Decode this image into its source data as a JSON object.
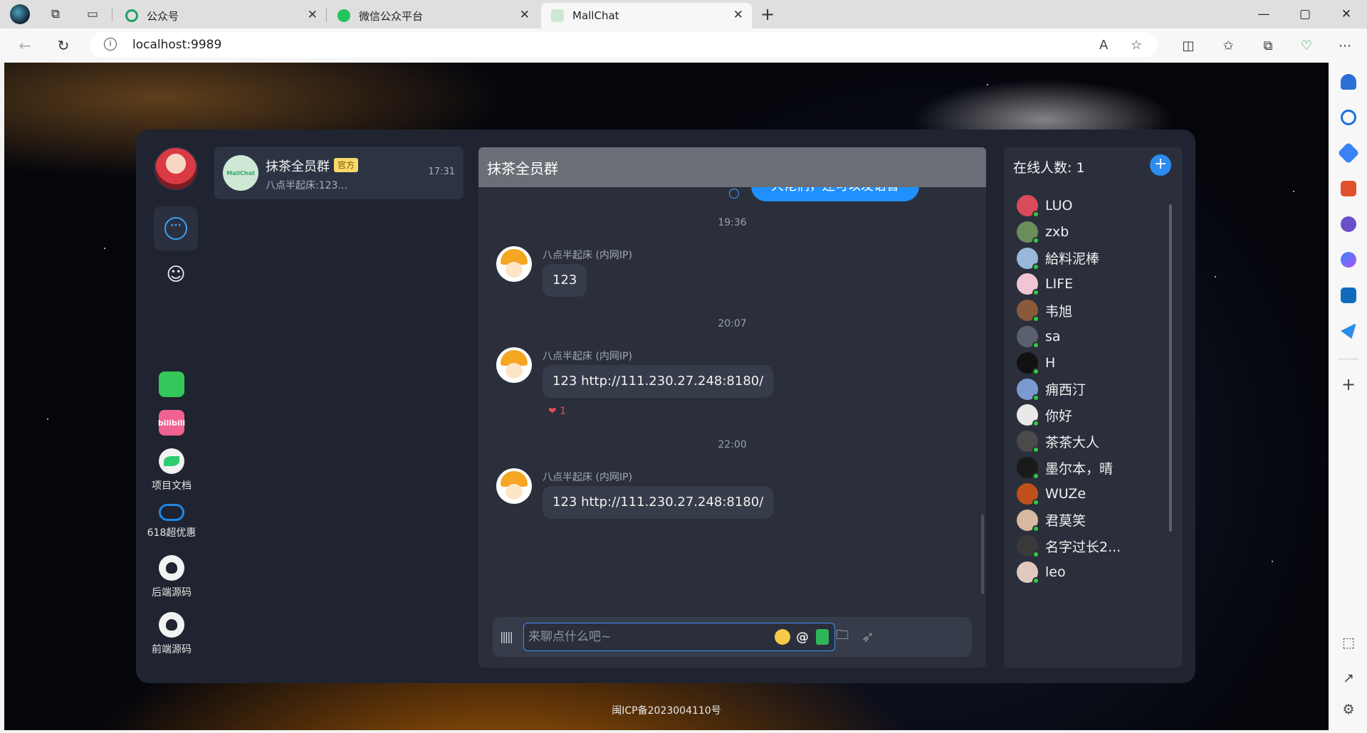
{
  "browser": {
    "tabs": [
      {
        "title": "公众号",
        "color": "#1aa260"
      },
      {
        "title": "微信公众平台",
        "color": "#22c55e"
      },
      {
        "title": "MallChat",
        "color": "#cfe8d5"
      }
    ],
    "url": "localhost:9989",
    "window_buttons": {
      "minimize": "—",
      "maximize": "▢",
      "close": "✕"
    }
  },
  "app": {
    "nav": {
      "links": [
        {
          "name": "wechat",
          "label": "",
          "icon_text": "",
          "color": "#34c759"
        },
        {
          "name": "bilibili",
          "label": "",
          "icon_text": "bilibili",
          "color": "#f06290"
        },
        {
          "name": "docs",
          "label": "项目文档",
          "icon_text": "",
          "color": "#2ecc71"
        },
        {
          "name": "promo",
          "label": "618超优惠",
          "icon_text": "",
          "color": "#1e88e5"
        },
        {
          "name": "backend-source",
          "label": "后端源码",
          "icon_text": "",
          "color": "#f2f2f2"
        },
        {
          "name": "frontend-source",
          "label": "前端源码",
          "icon_text": "",
          "color": "#f2f2f2"
        }
      ]
    },
    "conversation": {
      "name": "抹茶全员群",
      "badge": "官方",
      "time": "17:31",
      "preview": "八点半起床:123...",
      "avatar_text": "MallChat"
    },
    "chat": {
      "title": "抹茶全员群",
      "partial_message": "大佬们，还可以发语音",
      "messages": [
        {
          "time": "19:36",
          "sender": "八点半起床 (内网IP)",
          "text": "123",
          "reaction": null
        },
        {
          "time": "20:07",
          "sender": "八点半起床 (内网IP)",
          "text": "123 http://111.230.27.248:8180/",
          "reaction": {
            "icon": "❤",
            "count": "1"
          }
        },
        {
          "time": "22:00",
          "sender": "八点半起床 (内网IP)",
          "text": "123 http://111.230.27.248:8180/",
          "reaction": null
        }
      ],
      "input_placeholder": "来聊点什么吧~"
    },
    "online": {
      "title": "在线人数: 1",
      "users": [
        {
          "name": "LUO",
          "color": "#d94a5a"
        },
        {
          "name": "zxb",
          "color": "#6b8e5a"
        },
        {
          "name": "給料泥棒",
          "color": "#9ab8d8"
        },
        {
          "name": "LIFE",
          "color": "#f2c4d4"
        },
        {
          "name": "韦旭",
          "color": "#8a5a3a"
        },
        {
          "name": "sa",
          "color": "#5a6070"
        },
        {
          "name": "H",
          "color": "#111111"
        },
        {
          "name": "痈西汀",
          "color": "#7a9ad0"
        },
        {
          "name": "你好",
          "color": "#e8e8e8"
        },
        {
          "name": "茶茶大人",
          "color": "#4a4a4a"
        },
        {
          "name": "墨尔本，晴",
          "color": "#1a1a1a"
        },
        {
          "name": "WUZe",
          "color": "#c0501a"
        },
        {
          "name": "君莫笑",
          "color": "#d8b8a0"
        },
        {
          "name": "名字过长2...",
          "color": "#3a3a3a"
        },
        {
          "name": "leo",
          "color": "#e0c8c0"
        }
      ]
    }
  },
  "footer": {
    "icp": "闽ICP备2023004110号"
  }
}
